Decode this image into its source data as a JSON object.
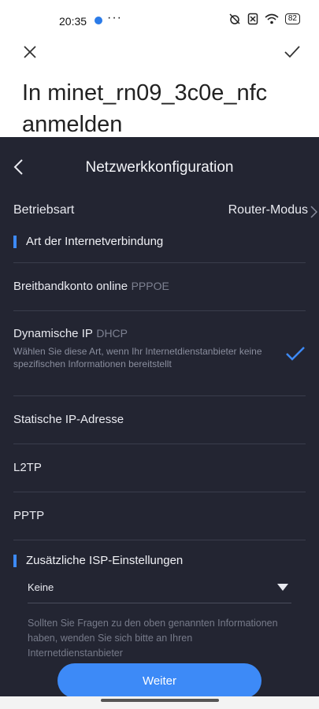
{
  "status": {
    "time": "20:35",
    "more": "···",
    "battery": "82"
  },
  "heading": "In minet_rn09_3c0e_nfc anmelden",
  "panel": {
    "title": "Netzwerkkonfiguration",
    "mode_label": "Betriebsart",
    "mode_value": "Router-Modus",
    "conn_section": "Art der Internetverbindung",
    "options": [
      {
        "label": "Breitbandkonto online",
        "sub": "PPPOE"
      },
      {
        "label": "Dynamische IP",
        "sub": "DHCP",
        "desc": "Wählen Sie diese Art, wenn Ihr Internetdienstanbieter keine spezifischen Informationen bereitstellt",
        "selected": true
      },
      {
        "label": "Statische IP-Adresse"
      },
      {
        "label": "L2TP"
      },
      {
        "label": "PPTP"
      }
    ],
    "isp_section": "Zusätzliche ISP-Einstellungen",
    "isp_value": "Keine",
    "isp_note": "Sollten Sie Fragen zu den oben genannten Informationen haben, wenden Sie sich bitte an Ihren Internetdienstanbieter",
    "button": "Weiter"
  },
  "colors": {
    "accent": "#3d8af7",
    "panel_bg": "#232532"
  },
  "icons": [
    "close-icon",
    "check-icon",
    "back-icon",
    "chevron-right-icon",
    "dropdown-triangle-icon",
    "selected-check-icon"
  ]
}
